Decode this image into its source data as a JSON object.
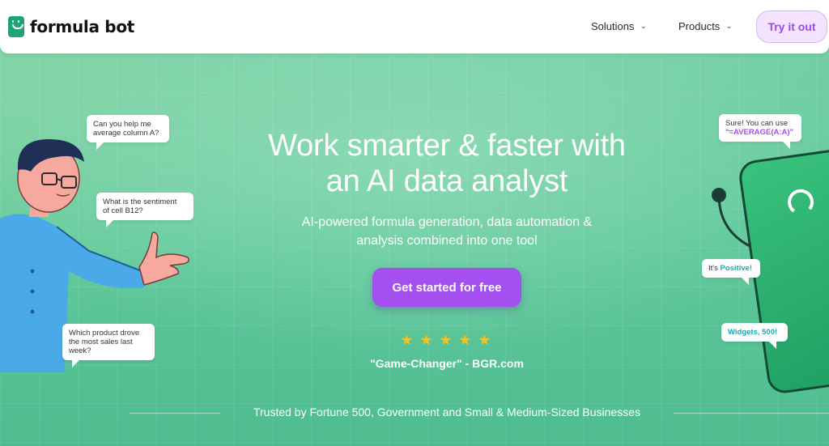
{
  "nav": {
    "brand": "formula bot",
    "items": [
      {
        "label": "Solutions",
        "chevron": "chevron-down-icon"
      },
      {
        "label": "Products",
        "chevron": "chevron-down-icon"
      }
    ],
    "cta_label": "Try it out"
  },
  "hero": {
    "headline_line1": "Work smarter & faster with",
    "headline_line2": "an AI data analyst",
    "sub_line1": "AI-powered formula generation, data automation &",
    "sub_line2": "analysis combined into one tool",
    "cta_label": "Get started for free",
    "rating_stars": 5,
    "quote": "\"Game-Changer\" - BGR.com",
    "trusted": "Trusted by Fortune 500, Government and Small & Medium-Sized Businesses"
  },
  "bubbles": {
    "left1_line1": "Can you help me",
    "left1_line2": "average column A?",
    "left2_line1": "What is the sentiment",
    "left2_line2": "of cell B12?",
    "left3_line1": "Which product drove",
    "left3_line2": "the most sales last",
    "left3_line3": "week?",
    "right1_line1": "Sure! You can use",
    "right1_formula": "\"=AVERAGE(A:A)\"",
    "right2_prefix": "It's ",
    "right2_value": "Positive!",
    "right3": "Widgets, 500!"
  },
  "colors": {
    "brand_green": "#21a37a",
    "cta_purple": "#a44ff0",
    "try_bg": "#f4e3ff",
    "star": "#f7c321"
  }
}
